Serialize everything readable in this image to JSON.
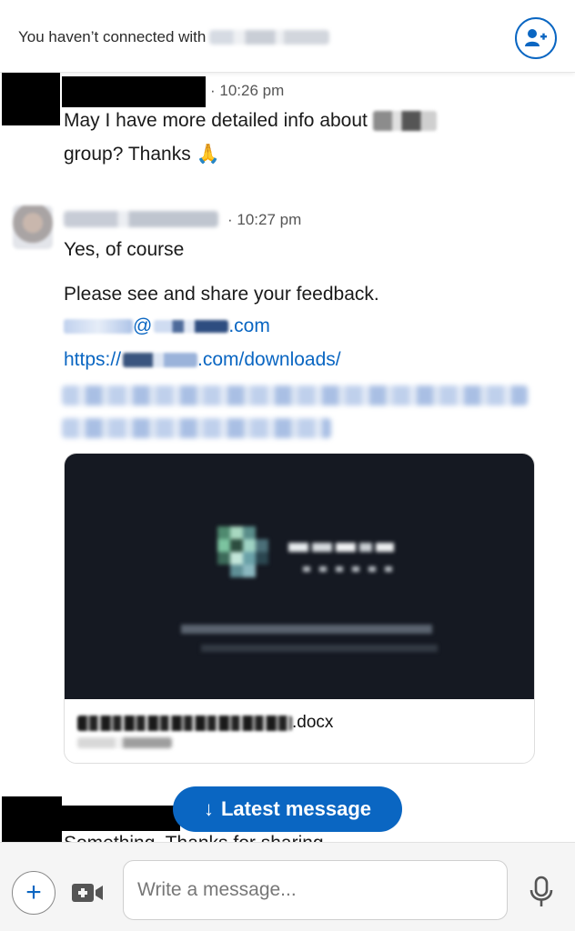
{
  "header": {
    "not_connected_text": "You haven’t connected with",
    "add_contact_icon": "person-add-icon"
  },
  "messages": [
    {
      "time": "· 10:26 pm",
      "text_line1": "May I have more detailed info about",
      "text_line2": "group? Thanks 🙏"
    },
    {
      "time": "· 10:27 pm",
      "reply": "Yes, of course",
      "body": "Please see and share your feedback.",
      "email_suffix": ".com",
      "email_at": "@",
      "url_prefix": "https://",
      "url_suffix": ".com/downloads/",
      "attachment": {
        "file_ext": ".docx"
      }
    }
  ],
  "latest_button": {
    "arrow": "↓",
    "label": "Latest message"
  },
  "partial_message": "Something. Thanks for sharing",
  "composer": {
    "placeholder": "Write a message...",
    "plus_label": "+",
    "icons": [
      "plus-icon",
      "video-icon",
      "microphone-icon"
    ]
  },
  "colors": {
    "accent": "#0a66c2",
    "preview_bg": "#151922"
  }
}
